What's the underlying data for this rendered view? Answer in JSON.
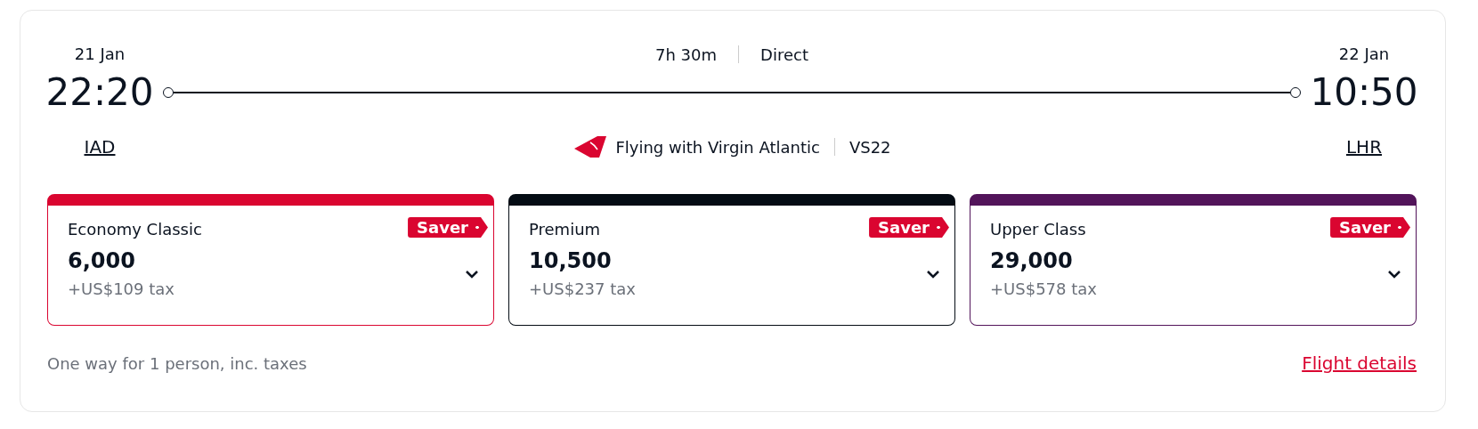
{
  "departure": {
    "date": "21 Jan",
    "time": "22:20",
    "airport": "IAD"
  },
  "arrival": {
    "date": "22 Jan",
    "time": "10:50",
    "airport": "LHR"
  },
  "journey": {
    "duration": "7h 30m",
    "stops": "Direct",
    "operator": "Flying with Virgin Atlantic",
    "flight_number": "VS22"
  },
  "fares": [
    {
      "cabin": "Economy Classic",
      "badge": "Saver",
      "points": "6,000",
      "tax": "+US$109 tax",
      "color": "#da0530"
    },
    {
      "cabin": "Premium",
      "badge": "Saver",
      "points": "10,500",
      "tax": "+US$237 tax",
      "color": "#040c14"
    },
    {
      "cabin": "Upper Class",
      "badge": "Saver",
      "points": "29,000",
      "tax": "+US$578 tax",
      "color": "#52145a"
    }
  ],
  "footer": {
    "note": "One way for 1 person, inc. taxes",
    "link": "Flight details"
  }
}
